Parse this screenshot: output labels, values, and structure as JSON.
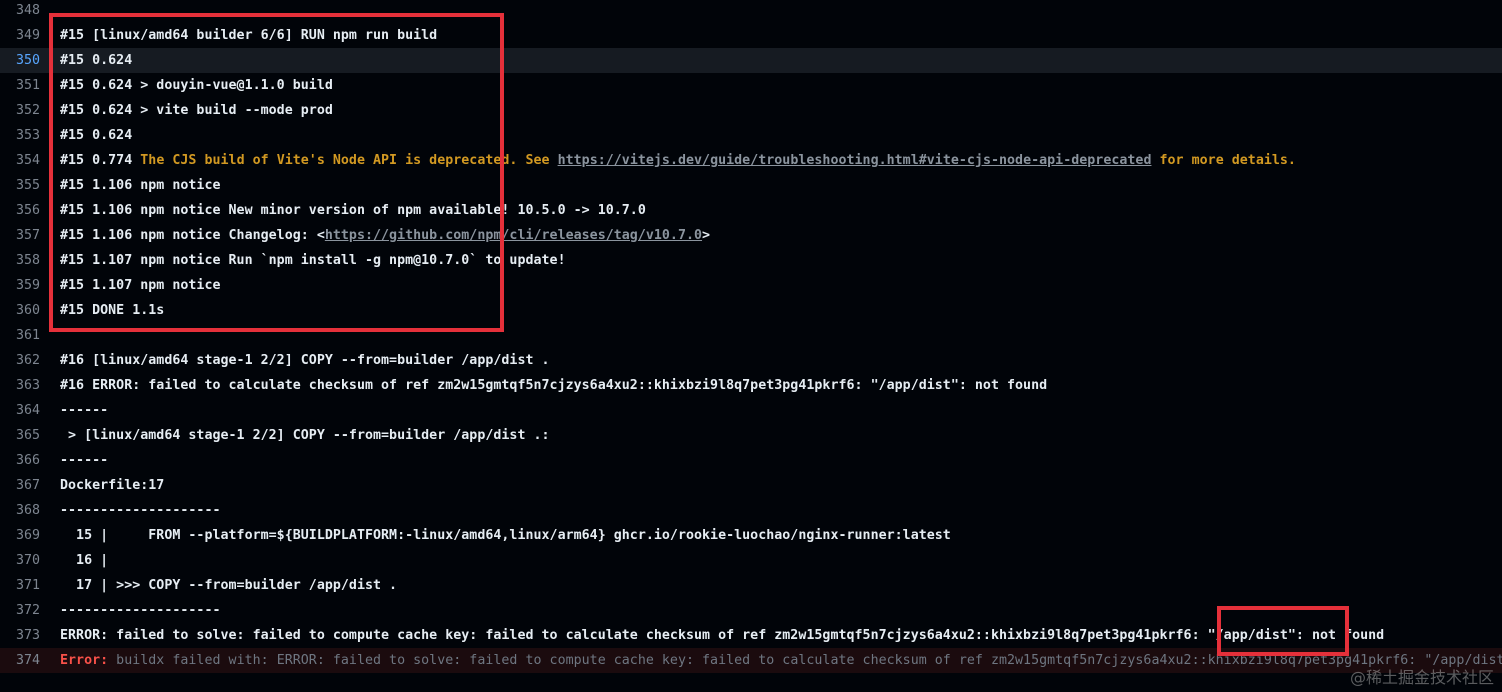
{
  "log": {
    "lines": [
      {
        "num": "348",
        "segments": []
      },
      {
        "num": "349",
        "segments": [
          {
            "t": "#15 [linux/amd64 builder 6/6] RUN npm run build"
          }
        ]
      },
      {
        "num": "350",
        "highlight": true,
        "segments": [
          {
            "t": "#15 0.624"
          }
        ]
      },
      {
        "num": "351",
        "segments": [
          {
            "t": "#15 0.624 > douyin-vue@1.1.0 build"
          }
        ]
      },
      {
        "num": "352",
        "segments": [
          {
            "t": "#15 0.624 > vite build --mode prod"
          }
        ]
      },
      {
        "num": "353",
        "segments": [
          {
            "t": "#15 0.624"
          }
        ]
      },
      {
        "num": "354",
        "segments": [
          {
            "t": "#15 0.774 "
          },
          {
            "t": "The CJS build of Vite's Node API is deprecated. See ",
            "cls": "warn"
          },
          {
            "t": "https://vitejs.dev/guide/troubleshooting.html#vite-cjs-node-api-deprecated",
            "cls": "link"
          },
          {
            "t": " for more details.",
            "cls": "warn"
          }
        ]
      },
      {
        "num": "355",
        "segments": [
          {
            "t": "#15 1.106 npm notice"
          }
        ]
      },
      {
        "num": "356",
        "segments": [
          {
            "t": "#15 1.106 npm notice New minor version of npm available! 10.5.0 -> 10.7.0"
          }
        ]
      },
      {
        "num": "357",
        "segments": [
          {
            "t": "#15 1.106 npm notice Changelog: <"
          },
          {
            "t": "https://github.com/npm/cli/releases/tag/v10.7.0",
            "cls": "link"
          },
          {
            "t": ">"
          }
        ]
      },
      {
        "num": "358",
        "segments": [
          {
            "t": "#15 1.107 npm notice Run `npm install -g npm@10.7.0` to update!"
          }
        ]
      },
      {
        "num": "359",
        "segments": [
          {
            "t": "#15 1.107 npm notice"
          }
        ]
      },
      {
        "num": "360",
        "segments": [
          {
            "t": "#15 DONE 1.1s"
          }
        ]
      },
      {
        "num": "361",
        "segments": []
      },
      {
        "num": "362",
        "segments": [
          {
            "t": "#16 [linux/amd64 stage-1 2/2] COPY --from=builder /app/dist ."
          }
        ]
      },
      {
        "num": "363",
        "segments": [
          {
            "t": "#16 ERROR: failed to calculate checksum of ref zm2w15gmtqf5n7cjzys6a4xu2::khixbzi9l8q7pet3pg41pkrf6: \"/app/dist\": not found"
          }
        ]
      },
      {
        "num": "364",
        "segments": [
          {
            "t": "------"
          }
        ]
      },
      {
        "num": "365",
        "segments": [
          {
            "t": " > [linux/amd64 stage-1 2/2] COPY --from=builder /app/dist .:"
          }
        ]
      },
      {
        "num": "366",
        "segments": [
          {
            "t": "------"
          }
        ]
      },
      {
        "num": "367",
        "segments": [
          {
            "t": "Dockerfile:17"
          }
        ]
      },
      {
        "num": "368",
        "segments": [
          {
            "t": "--------------------"
          }
        ]
      },
      {
        "num": "369",
        "segments": [
          {
            "t": "  15 |     FROM --platform=${BUILDPLATFORM:-linux/amd64,linux/arm64} ghcr.io/rookie-luochao/nginx-runner:latest"
          }
        ]
      },
      {
        "num": "370",
        "segments": [
          {
            "t": "  16 |"
          }
        ]
      },
      {
        "num": "371",
        "segments": [
          {
            "t": "  17 | >>> COPY --from=builder /app/dist ."
          }
        ]
      },
      {
        "num": "372",
        "segments": [
          {
            "t": "--------------------"
          }
        ]
      },
      {
        "num": "373",
        "segments": [
          {
            "t": "ERROR: failed to solve: failed to compute cache key: failed to calculate checksum of ref zm2w15gmtqf5n7cjzys6a4xu2::khixbzi9l8q7pet3pg41pkrf6: \"/app/dist\": not found"
          }
        ]
      },
      {
        "num": "374",
        "error": true,
        "segments": [
          {
            "t": "Error:",
            "cls": "err-label"
          },
          {
            "t": " buildx failed with: ERROR: failed to solve: failed to compute cache key: failed to calculate checksum of ref zm2w15gmtqf5n7cjzys6a4xu2::khixbzi9l8q7pet3pg41pkrf6: \"/app/dist\": not found",
            "cls": "faded"
          }
        ]
      }
    ]
  },
  "annotations": {
    "box_color": "#e5303a"
  },
  "watermark": "@稀土掘金技术社区"
}
